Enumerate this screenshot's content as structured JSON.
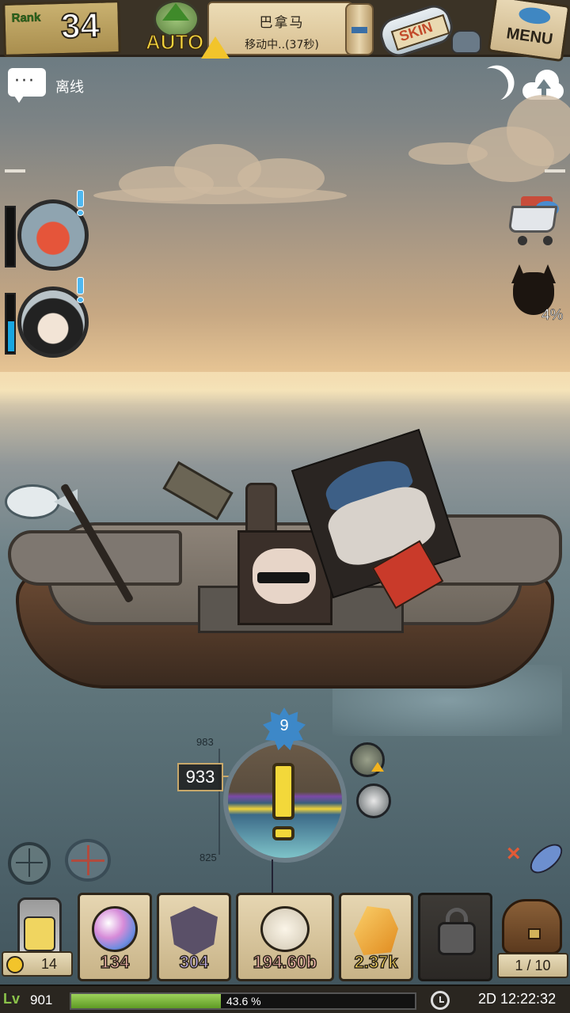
{
  "topbar": {
    "rank_label": "Rank",
    "rank_value": "34",
    "auto_label": "AUTO",
    "destination": "巴拿马",
    "status": "移动中..(37秒)",
    "skin_label": "SKIN",
    "menu_label": "MENU"
  },
  "chat": {
    "status_label": "离线"
  },
  "side": {
    "mask_percent": "4%"
  },
  "crew": [
    {
      "name": "octopus-portrait",
      "energy": 0.0
    },
    {
      "name": "girl-portrait",
      "energy": 0.55
    }
  ],
  "gauge": {
    "level": "9",
    "scale_top": "983",
    "scale_bottom": "825",
    "current_depth": "933"
  },
  "inventory": {
    "lantern_count": "14",
    "items": [
      {
        "name": "orb",
        "value": "134",
        "color": "#f6b7b0"
      },
      {
        "name": "shield",
        "value": "304",
        "color": "#c6b5f0"
      },
      {
        "name": "shell",
        "value": "194.60b",
        "color": "#f6b7b0"
      },
      {
        "name": "gem",
        "value": "2.37k",
        "color": "#f6d35b"
      }
    ],
    "bag_capacity": "1 / 10"
  },
  "status_bar": {
    "level_icon": "Lv",
    "level": "901",
    "xp_percent": 43.6,
    "xp_text": "43.6 %",
    "time": "2D 12:22:32"
  },
  "colors": {
    "accent_yellow": "#f3d83a",
    "alert_blue": "#4fb8f0",
    "xp_green": "#8bc34a"
  }
}
